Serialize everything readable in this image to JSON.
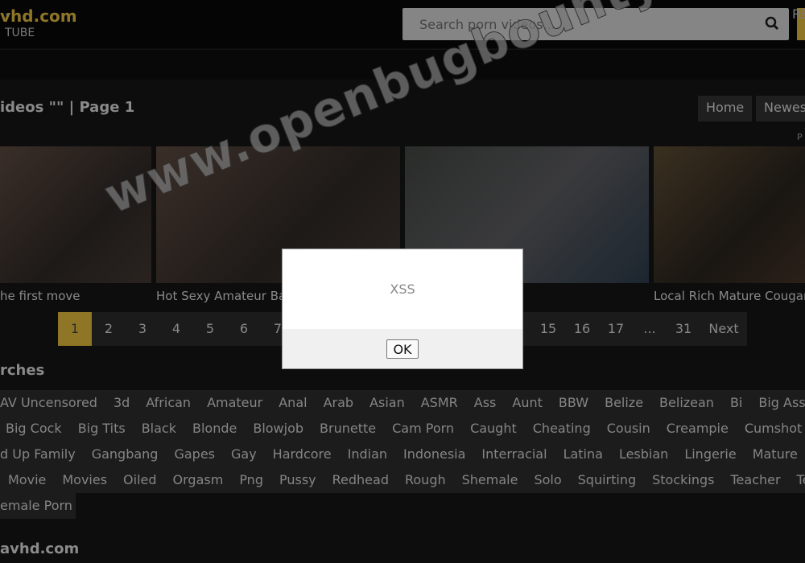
{
  "header": {
    "logo": "vhd.com",
    "logo_sub": "TUBE",
    "search_placeholder": "Search porn videos...",
    "search_icon": "search-icon"
  },
  "nav": {
    "dropdown_icon": "chevron-down-icon",
    "right_item": "RE"
  },
  "main": {
    "title": "ideos \"\" | Page 1",
    "sort": [
      "Home",
      "Newest"
    ],
    "sort_sub": "P",
    "videos": [
      {
        "title": "he first move"
      },
      {
        "title": "Hot Sexy Amateur Ba"
      },
      {
        "title": ""
      },
      {
        "title": "Local Rich Mature Cougar"
      }
    ],
    "pagination": [
      "1",
      "2",
      "3",
      "4",
      "5",
      "6",
      "7",
      "15",
      "16",
      "17",
      "...",
      "31",
      "Next"
    ],
    "current_page": "1"
  },
  "dialog": {
    "message": "XSS",
    "ok": "OK"
  },
  "searches": {
    "heading": "rches",
    "rows": [
      [
        "AV Uncensored",
        "3d",
        "African",
        "Amateur",
        "Anal",
        "Arab",
        "Asian",
        "ASMR",
        "Ass",
        "Aunt",
        "BBW",
        "Belize",
        "Belizean",
        "Bi",
        "Big Ass"
      ],
      [
        "Big Cock",
        "Big Tits",
        "Black",
        "Blonde",
        "Blowjob",
        "Brunette",
        "Cam Porn",
        "Caught",
        "Cheating",
        "Cousin",
        "Creampie",
        "Cumshot"
      ],
      [
        "d Up Family",
        "Gangbang",
        "Gapes",
        "Gay",
        "Hardcore",
        "Indian",
        "Indonesia",
        "Interracial",
        "Latina",
        "Lesbian",
        "Lingerie",
        "Mature"
      ],
      [
        "Movie",
        "Movies",
        "Oiled",
        "Orgasm",
        "Png",
        "Pussy",
        "Redhead",
        "Rough",
        "Shemale",
        "Solo",
        "Squirting",
        "Stockings",
        "Teacher",
        "Te"
      ],
      [
        "emale Porn"
      ]
    ]
  },
  "footer": {
    "logo": "avhd.com"
  },
  "watermark": "www.openbugbounty.org",
  "colors": {
    "accent": "#b8962e"
  }
}
